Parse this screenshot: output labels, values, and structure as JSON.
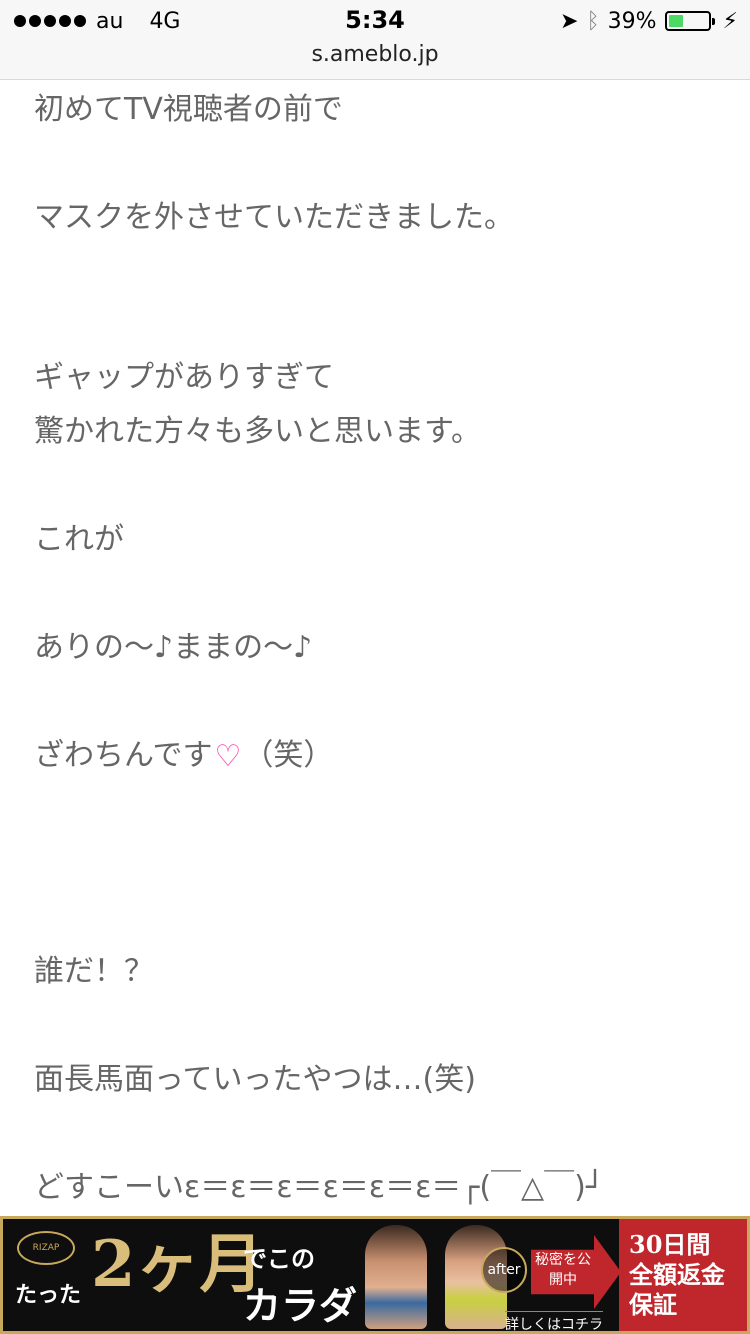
{
  "status_bar": {
    "carrier": "au",
    "network": "4G",
    "time": "5:34",
    "battery_percent": "39%",
    "battery_level": 0.39,
    "url": "s.ameblo.jp"
  },
  "article": {
    "lines": [
      "初めてTV視聴者の前で",
      "マスクを外させていただきました。",
      "ギャップがありすぎて",
      "驚かれた方々も多いと思います。",
      "これが",
      "ありの〜♪ままの〜♪",
      "ざわちんです",
      "（笑）",
      "誰だ！？",
      "面長馬面っていったやつは…(笑)",
      "どすこーいε＝ε＝ε＝ε＝ε＝ε＝┌(￣△￣)┘"
    ],
    "emoji": "heart-icon"
  },
  "ad": {
    "logo": "RIZAP",
    "prefix": "たった",
    "headline": "2ヶ月",
    "deko": "でこの",
    "karada": "カラダ",
    "after_label": "after",
    "secret_text": "秘密を公開中",
    "cta": "詳しくはコチラ",
    "guarantee_1": "30日間",
    "guarantee_2": "全額返金",
    "guarantee_3": "保証"
  }
}
